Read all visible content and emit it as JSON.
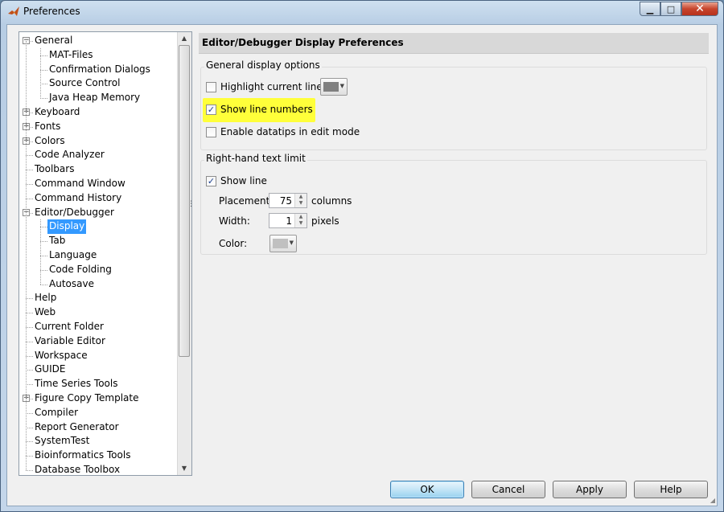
{
  "window": {
    "title": "Preferences",
    "minimize": "▁",
    "maximize": "□",
    "close": "✕"
  },
  "tree": {
    "items": [
      {
        "label": "General",
        "level": 0,
        "expander": "−"
      },
      {
        "label": "MAT-Files",
        "level": 1
      },
      {
        "label": "Confirmation Dialogs",
        "level": 1
      },
      {
        "label": "Source Control",
        "level": 1
      },
      {
        "label": "Java Heap Memory",
        "level": 1
      },
      {
        "label": "Keyboard",
        "level": 0,
        "expander": "+"
      },
      {
        "label": "Fonts",
        "level": 0,
        "expander": "+"
      },
      {
        "label": "Colors",
        "level": 0,
        "expander": "+"
      },
      {
        "label": "Code Analyzer",
        "level": 0
      },
      {
        "label": "Toolbars",
        "level": 0
      },
      {
        "label": "Command Window",
        "level": 0
      },
      {
        "label": "Command History",
        "level": 0
      },
      {
        "label": "Editor/Debugger",
        "level": 0,
        "expander": "−"
      },
      {
        "label": "Display",
        "level": 1,
        "selected": true
      },
      {
        "label": "Tab",
        "level": 1
      },
      {
        "label": "Language",
        "level": 1
      },
      {
        "label": "Code Folding",
        "level": 1
      },
      {
        "label": "Autosave",
        "level": 1
      },
      {
        "label": "Help",
        "level": 0
      },
      {
        "label": "Web",
        "level": 0
      },
      {
        "label": "Current Folder",
        "level": 0
      },
      {
        "label": "Variable Editor",
        "level": 0
      },
      {
        "label": "Workspace",
        "level": 0
      },
      {
        "label": "GUIDE",
        "level": 0
      },
      {
        "label": "Time Series Tools",
        "level": 0
      },
      {
        "label": "Figure Copy Template",
        "level": 0,
        "expander": "+"
      },
      {
        "label": "Compiler",
        "level": 0
      },
      {
        "label": "Report Generator",
        "level": 0
      },
      {
        "label": "SystemTest",
        "level": 0
      },
      {
        "label": "Bioinformatics Tools",
        "level": 0
      },
      {
        "label": "Database Toolbox",
        "level": 0
      }
    ]
  },
  "panel": {
    "title": "Editor/Debugger Display Preferences",
    "general": {
      "label": "General display options",
      "highlight_current_line": {
        "label": "Highlight current line",
        "checked": false,
        "color": "#808080"
      },
      "show_line_numbers": {
        "label": "Show line numbers",
        "checked": true
      },
      "enable_datatips": {
        "label": "Enable datatips in edit mode",
        "checked": false
      }
    },
    "right_hand": {
      "label": "Right-hand text limit",
      "show_line": {
        "label": "Show line",
        "checked": true
      },
      "placement": {
        "label": "Placement:",
        "value": "75",
        "unit": "columns"
      },
      "width": {
        "label": "Width:",
        "value": "1",
        "unit": "pixels"
      },
      "color": {
        "label": "Color:",
        "value": "#c0c0c0"
      }
    }
  },
  "buttons": {
    "ok": "OK",
    "cancel": "Cancel",
    "apply": "Apply",
    "help": "Help"
  },
  "colors": {
    "highlight": "#ffff3a",
    "selection": "#3399ff"
  }
}
